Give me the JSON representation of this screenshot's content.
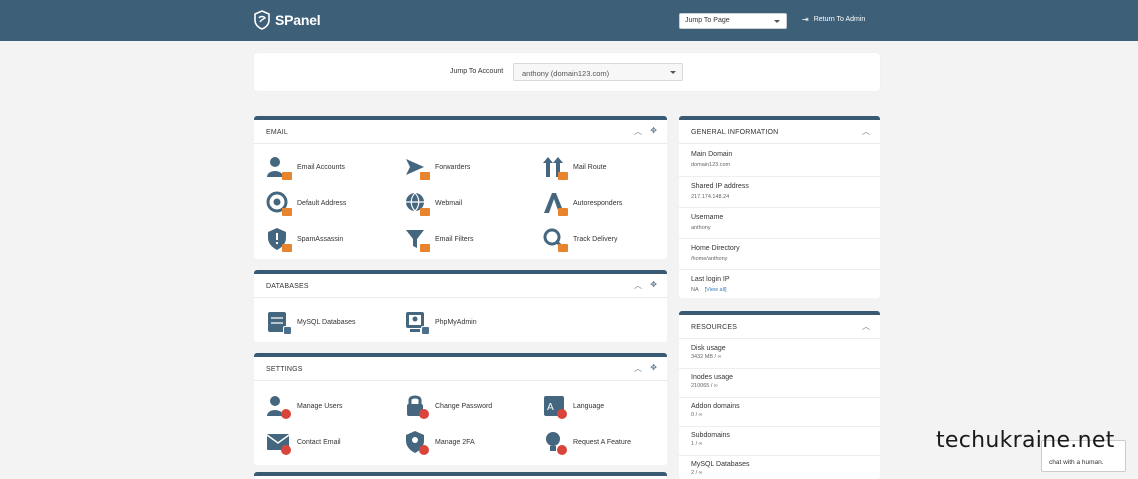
{
  "brand": {
    "name": "SPanel"
  },
  "topbar": {
    "jump_to_page": "Jump To Page",
    "return_admin": "Return To Admin"
  },
  "jump_account": {
    "label": "Jump To Account",
    "selected": "anthony (domain123.com)"
  },
  "email": {
    "title": "EMAIL",
    "items": [
      {
        "label": "Email Accounts",
        "icon": "user-email-icon"
      },
      {
        "label": "Forwarders",
        "icon": "forward-email-icon"
      },
      {
        "label": "Mail Route",
        "icon": "route-email-icon"
      },
      {
        "label": "Default Address",
        "icon": "at-email-icon"
      },
      {
        "label": "Webmail",
        "icon": "globe-email-icon"
      },
      {
        "label": "Autoresponders",
        "icon": "auto-email-icon"
      },
      {
        "label": "SpamAssassin",
        "icon": "shield-email-icon"
      },
      {
        "label": "Email Filters",
        "icon": "filter-email-icon"
      },
      {
        "label": "Track Delivery",
        "icon": "search-email-icon"
      }
    ]
  },
  "databases": {
    "title": "DATABASES",
    "items": [
      {
        "label": "MySQL Databases",
        "icon": "database-icon"
      },
      {
        "label": "PhpMyAdmin",
        "icon": "phpmyadmin-icon"
      }
    ]
  },
  "settings": {
    "title": "SETTINGS",
    "items": [
      {
        "label": "Manage Users",
        "icon": "users-gear-icon"
      },
      {
        "label": "Change Password",
        "icon": "lock-gear-icon"
      },
      {
        "label": "Language",
        "icon": "language-gear-icon"
      },
      {
        "label": "Contact Email",
        "icon": "envelope-gear-icon"
      },
      {
        "label": "Manage 2FA",
        "icon": "twofa-gear-icon"
      },
      {
        "label": "Request A Feature",
        "icon": "bulb-gear-icon"
      }
    ]
  },
  "general": {
    "title": "GENERAL INFORMATION",
    "rows": [
      {
        "key": "Main Domain",
        "value": "domain123.com"
      },
      {
        "key": "Shared IP address",
        "value": "217.174.148.24"
      },
      {
        "key": "Username",
        "value": "anthony"
      },
      {
        "key": "Home Directory",
        "value": "/home/anthony"
      },
      {
        "key": "Last login IP",
        "value": "NA",
        "link": "[View all]"
      }
    ]
  },
  "resources": {
    "title": "RESOURCES",
    "rows": [
      {
        "key": "Disk usage",
        "value": "3432 MB / ∞"
      },
      {
        "key": "Inodes usage",
        "value": "210065 / ∞"
      },
      {
        "key": "Addon domains",
        "value": "0 / ∞"
      },
      {
        "key": "Subdomains",
        "value": "1 / ∞"
      },
      {
        "key": "MySQL Databases",
        "value": "2 / ∞"
      }
    ]
  },
  "chat": {
    "text": "chat with a human."
  },
  "watermark": "techukraine.net",
  "colors": {
    "topbar": "#3e5f78",
    "card_border": "#3a5a73",
    "badge_orange": "#e8842d",
    "badge_red": "#d9453b"
  }
}
